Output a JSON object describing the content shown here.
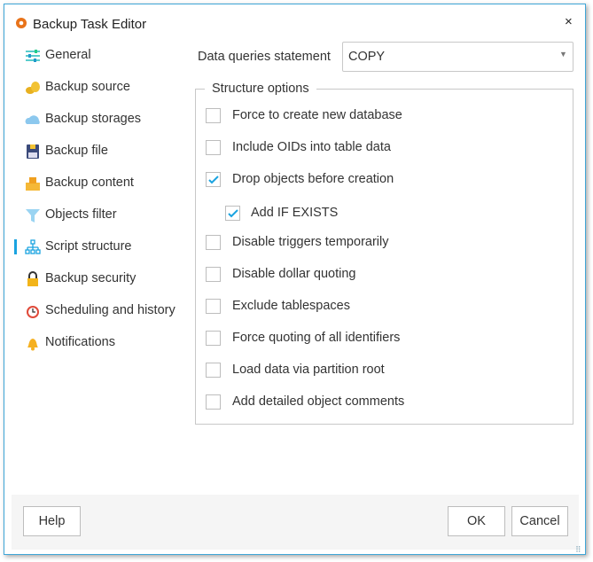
{
  "window": {
    "title": "Backup Task Editor",
    "close": "×",
    "accent": "#1aa3e0"
  },
  "sidebar": {
    "selected": "Script structure",
    "items": [
      {
        "label": "General",
        "icon": "sliders-icon"
      },
      {
        "label": "Backup source",
        "icon": "coins-icon"
      },
      {
        "label": "Backup storages",
        "icon": "cloud-icon"
      },
      {
        "label": "Backup file",
        "icon": "floppy-icon"
      },
      {
        "label": "Backup content",
        "icon": "boxes-icon"
      },
      {
        "label": "Objects filter",
        "icon": "filter-icon"
      },
      {
        "label": "Script structure",
        "icon": "hierarchy-icon"
      },
      {
        "label": "Backup security",
        "icon": "lock-icon"
      },
      {
        "label": "Scheduling and history",
        "icon": "alarm-clock-icon"
      },
      {
        "label": "Notifications",
        "icon": "bell-icon"
      }
    ]
  },
  "main": {
    "data_queries_label": "Data queries statement",
    "data_queries_value": "COPY",
    "group_title": "Structure options",
    "options": [
      {
        "label": "Force to create new database",
        "checked": false
      },
      {
        "label": "Include OIDs into table data",
        "checked": false
      },
      {
        "label": "Drop objects before creation",
        "checked": true
      },
      {
        "label": "Add IF EXISTS",
        "checked": true,
        "indent": true
      },
      {
        "label": "Disable triggers temporarily",
        "checked": false
      },
      {
        "label": "Disable dollar quoting",
        "checked": false
      },
      {
        "label": "Exclude tablespaces",
        "checked": false
      },
      {
        "label": "Force quoting of all identifiers",
        "checked": false
      },
      {
        "label": "Load data via partition root",
        "checked": false
      },
      {
        "label": "Add detailed object comments",
        "checked": false
      }
    ]
  },
  "footer": {
    "help": "Help",
    "ok": "OK",
    "cancel": "Cancel"
  }
}
